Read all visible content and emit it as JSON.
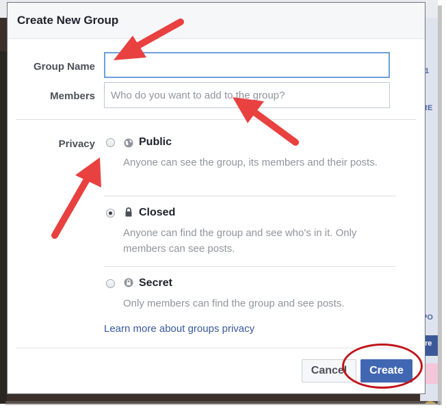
{
  "background_page": {
    "top_text": "",
    "side_chips": [
      "1",
      "RE",
      "PO",
      "re"
    ]
  },
  "dialog": {
    "title": "Create New Group",
    "group_name": {
      "label": "Group Name",
      "value": "",
      "placeholder": ""
    },
    "members": {
      "label": "Members",
      "value": "",
      "placeholder": "Who do you want to add to the group?"
    },
    "privacy": {
      "label": "Privacy",
      "selected": "Closed",
      "options": [
        {
          "title": "Public",
          "icon": "globe-icon",
          "description": "Anyone can see the group, its members and their posts."
        },
        {
          "title": "Closed",
          "icon": "lock-icon",
          "description": "Anyone can find the group and see who's in it. Only members can see posts."
        },
        {
          "title": "Secret",
          "icon": "lock-outline-icon",
          "description": "Only members can find the group and see posts."
        }
      ]
    },
    "learn_more_link": "Learn more about groups privacy",
    "buttons": {
      "cancel": "Cancel",
      "create": "Create"
    }
  },
  "annotations": {
    "arrow_color": "#e8413f",
    "circle_color": "#c0141a"
  },
  "colors": {
    "primary_button": "#4267b2",
    "link": "#365899",
    "focus_border": "#6b9fd8"
  }
}
